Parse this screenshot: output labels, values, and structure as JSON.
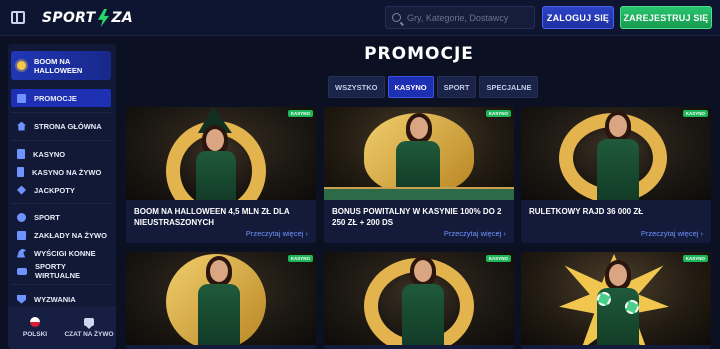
{
  "header": {
    "logo_text": "SPORTAZA",
    "search_placeholder": "Gry, Kategorie, Dostawcy",
    "login_label": "ZALOGUJ SIĘ",
    "register_label": "ZAREJESTRUJ SIĘ"
  },
  "sidebar": {
    "promo_banner": "BOOM NA HALLOWEEN",
    "items": [
      {
        "label": "PROMOCJE",
        "icon": "gift-icon"
      },
      {
        "label": "STRONA GŁÓWNA",
        "icon": "home-icon"
      },
      {
        "label": "KASYNO",
        "icon": "cards-icon"
      },
      {
        "label": "KASYNO NA ŻYWO",
        "icon": "live-casino-icon"
      },
      {
        "label": "JACKPOTY",
        "icon": "jackpot-icon"
      },
      {
        "label": "SPORT",
        "icon": "ball-icon"
      },
      {
        "label": "ZAKŁADY NA ŻYWO",
        "icon": "live-bet-icon"
      },
      {
        "label": "WYŚCIGI KONNE",
        "icon": "horse-icon"
      },
      {
        "label": "SPORTY WIRTUALNE",
        "icon": "virtual-icon"
      },
      {
        "label": "WYZWANIA",
        "icon": "challenge-icon"
      }
    ],
    "bottom": {
      "language": "POLSKI",
      "chat": "CZAT NA ŻYWO"
    }
  },
  "main": {
    "title": "PROMOCJE",
    "tabs": [
      "WSZYSTKO",
      "KASYNO",
      "SPORT",
      "SPECJALNE"
    ],
    "active_tab": "KASYNO",
    "cards": [
      {
        "title": "BOOM NA HALLOWEEN 4,5 MLN ZŁ DLA NIEUSTRASZONYCH",
        "more": "Przeczytaj więcej ›",
        "badge": "KASYNO"
      },
      {
        "title": "BONUS POWITALNY W KASYNIE 100% DO 2 250 ZŁ + 200 DS",
        "more": "Przeczytaj więcej ›",
        "badge": "KASYNO"
      },
      {
        "title": "RULETKOWY RAJD 36 000 ZŁ",
        "more": "Przeczytaj więcej ›",
        "badge": "KASYNO"
      },
      {
        "title": "",
        "more": "",
        "badge": "KASYNO"
      },
      {
        "title": "",
        "more": "",
        "badge": "KASYNO"
      },
      {
        "title": "",
        "more": "",
        "badge": "KASYNO"
      }
    ]
  },
  "colors": {
    "background": "#0b1023",
    "accent_blue": "#1d2fb3",
    "accent_green": "#1fb65a",
    "gold": "#e3b34d"
  }
}
